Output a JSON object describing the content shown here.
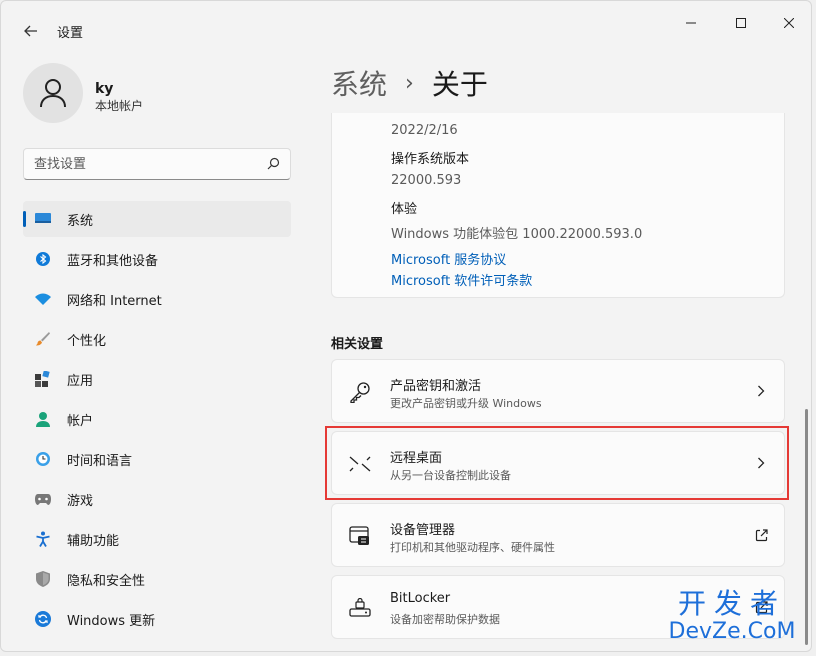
{
  "window": {
    "title": "设置"
  },
  "user": {
    "name": "ky",
    "account_type": "本地帐户"
  },
  "search": {
    "placeholder": "查找设置"
  },
  "nav": {
    "items": [
      {
        "label": "系统",
        "icon": "system-icon",
        "active": true
      },
      {
        "label": "蓝牙和其他设备",
        "icon": "bluetooth-icon"
      },
      {
        "label": "网络和 Internet",
        "icon": "wifi-icon"
      },
      {
        "label": "个性化",
        "icon": "brush-icon"
      },
      {
        "label": "应用",
        "icon": "apps-icon"
      },
      {
        "label": "帐户",
        "icon": "account-icon"
      },
      {
        "label": "时间和语言",
        "icon": "time-language-icon"
      },
      {
        "label": "游戏",
        "icon": "gamepad-icon"
      },
      {
        "label": "辅助功能",
        "icon": "accessibility-icon"
      },
      {
        "label": "隐私和安全性",
        "icon": "shield-icon"
      },
      {
        "label": "Windows 更新",
        "icon": "update-icon"
      }
    ]
  },
  "breadcrumb": {
    "parent": "系统",
    "separator": "›",
    "current": "关于"
  },
  "specs": {
    "install_date": "2022/2/16",
    "os_build_label": "操作系统版本",
    "os_build": "22000.593",
    "experience_label": "体验",
    "experience": "Windows 功能体验包 1000.22000.593.0",
    "link_services": "Microsoft 服务协议",
    "link_license": "Microsoft 软件许可条款"
  },
  "related": {
    "title": "相关设置",
    "items": [
      {
        "title": "产品密钥和激活",
        "subtitle": "更改产品密钥或升级 Windows",
        "icon": "key-icon",
        "action": "chevron-right-icon"
      },
      {
        "title": "远程桌面",
        "subtitle": "从另一台设备控制此设备",
        "icon": "remote-desktop-icon",
        "action": "chevron-right-icon"
      },
      {
        "title": "设备管理器",
        "subtitle": "打印机和其他驱动程序、硬件属性",
        "icon": "device-manager-icon",
        "action": "external-link-icon"
      },
      {
        "title": "BitLocker",
        "subtitle": "设备加密帮助保护数据",
        "icon": "bitlocker-icon",
        "action": "external-link-icon"
      }
    ]
  },
  "watermark": {
    "top": "开发者",
    "bottom": "DevZe.CoM"
  },
  "colors": {
    "accent": "#005fb8",
    "highlight": "#e53935",
    "watermark": "#1e6fd9"
  }
}
